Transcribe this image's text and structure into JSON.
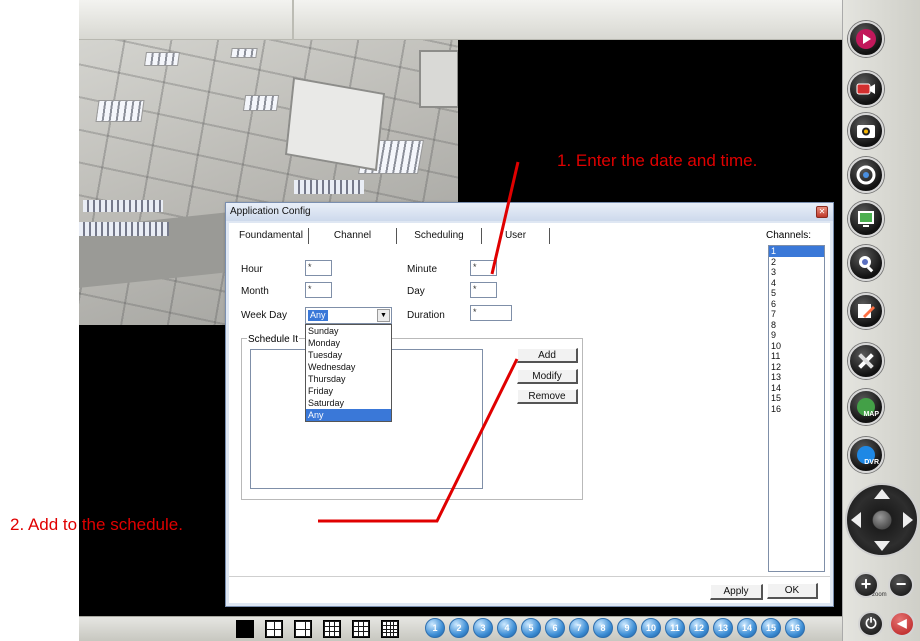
{
  "dialog": {
    "title": "Application Config",
    "close_icon": "close-icon",
    "tabs": [
      {
        "label": "Foundamental",
        "active": false
      },
      {
        "label": "Channel",
        "active": false
      },
      {
        "label": "Scheduling",
        "active": true
      },
      {
        "label": "User",
        "active": false
      }
    ],
    "scheduling": {
      "hour": {
        "label": "Hour",
        "value": "*"
      },
      "minute": {
        "label": "Minute",
        "value": "*"
      },
      "month": {
        "label": "Month",
        "value": "*"
      },
      "day": {
        "label": "Day",
        "value": "*"
      },
      "week_day": {
        "label": "Week Day",
        "selected": "Any",
        "options": [
          "Sunday",
          "Monday",
          "Tuesday",
          "Wednesday",
          "Thursday",
          "Friday",
          "Saturday",
          "Any"
        ],
        "highlighted": "Any"
      },
      "duration": {
        "label": "Duration",
        "value": "*"
      },
      "schedule_group_label": "Schedule It",
      "buttons": {
        "add": "Add",
        "modify": "Modify",
        "remove": "Remove"
      }
    },
    "channels": {
      "label": "Channels:",
      "items": [
        "1",
        "2",
        "3",
        "4",
        "5",
        "6",
        "7",
        "8",
        "9",
        "10",
        "11",
        "12",
        "13",
        "14",
        "15",
        "16"
      ],
      "selected": "1"
    },
    "footer": {
      "apply": "Apply",
      "ok": "OK"
    }
  },
  "annotations": {
    "step1": "1. Enter the date and time.",
    "step2": "2. Add to the schedule.",
    "color": "#e00000"
  },
  "sidebar": {
    "buttons": [
      {
        "icon": "play-icon"
      },
      {
        "icon": "record-icon"
      },
      {
        "icon": "snapshot-camera-icon"
      },
      {
        "icon": "refresh-icon"
      },
      {
        "icon": "monitor-icon"
      },
      {
        "icon": "search-icon"
      },
      {
        "icon": "edit-icon"
      },
      {
        "icon": "tools-icon"
      },
      {
        "icon": "map-icon",
        "label": "MAP"
      },
      {
        "icon": "dvr-icon",
        "label": "DVR"
      }
    ],
    "ptz": {
      "icon": "ptz-joystick-icon"
    },
    "zoom_in": "+",
    "zoom_out": "−",
    "zoom_label": "zoom",
    "power_icon": "power-icon",
    "volume_icon": "volume-icon"
  },
  "bottom_bar": {
    "layouts": [
      "layout-1-icon",
      "layout-4-icon",
      "layout-6-icon",
      "layout-9-icon",
      "layout-13-icon",
      "layout-16-icon"
    ],
    "channel_buttons": [
      "1",
      "2",
      "3",
      "4",
      "5",
      "6",
      "7",
      "8",
      "9",
      "10",
      "11",
      "12",
      "13",
      "14",
      "15",
      "16"
    ]
  },
  "colors": {
    "selection": "#3a78d8",
    "annotation": "#e00000",
    "dialog_frame": "#dfe7f3"
  }
}
